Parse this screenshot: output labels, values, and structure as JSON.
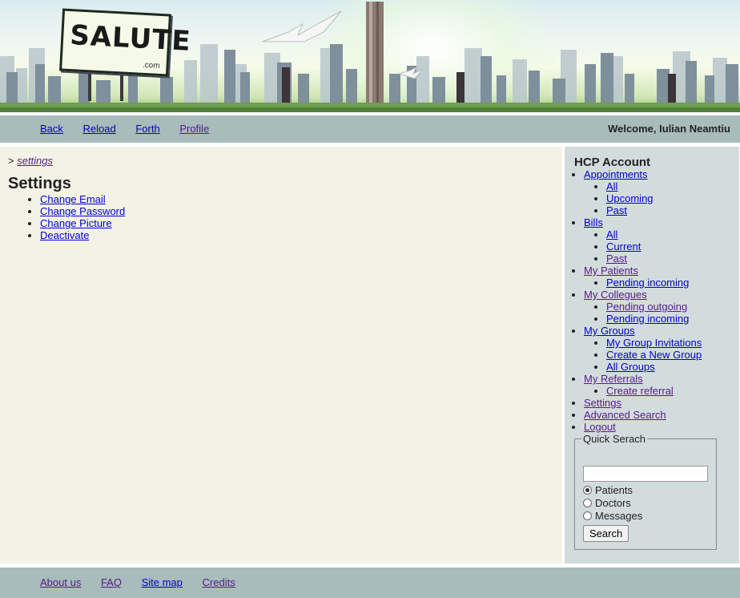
{
  "banner": {
    "logo_text": "SALUTE",
    "logo_sub": ".com"
  },
  "topbar": {
    "nav": [
      {
        "label": "Back",
        "visited": false
      },
      {
        "label": "Reload",
        "visited": false
      },
      {
        "label": "Forth",
        "visited": false
      },
      {
        "label": "Profile",
        "visited": true
      }
    ],
    "welcome": "Welcome, Iulian Neamtiu"
  },
  "main": {
    "breadcrumb_prefix": ">",
    "breadcrumb_link": "settings",
    "title": "Settings",
    "items": [
      "Change Email",
      "Change Password",
      "Change Picture",
      "Deactivate"
    ]
  },
  "sidebar": {
    "title": "HCP Account",
    "sections": [
      {
        "label": "Appointments",
        "children": [
          "All",
          "Upcoming",
          "Past"
        ]
      },
      {
        "label": "Bills",
        "children": [
          "All",
          "Current",
          "Past"
        ]
      },
      {
        "label": "My Patients",
        "children": [
          "Pending incoming"
        ]
      },
      {
        "label": "My Collegues",
        "children": [
          "Pending outgoing",
          "Pending incoming"
        ]
      },
      {
        "label": "My Groups",
        "children": [
          "My Group Invitations",
          "Create a New Group",
          "All Groups"
        ]
      },
      {
        "label": "My Referrals",
        "children": [
          "Create referral"
        ]
      },
      {
        "label": "Settings",
        "children": []
      },
      {
        "label": "Advanced Search",
        "children": []
      },
      {
        "label": "Logout",
        "children": []
      }
    ],
    "quick_search": {
      "legend": "Quick Serach",
      "input_value": "",
      "options": [
        "Patients",
        "Doctors",
        "Messages"
      ],
      "selected": "Patients",
      "button": "Search"
    }
  },
  "footer": {
    "links": [
      "About us",
      "FAQ",
      "Site map",
      "Credits"
    ]
  },
  "colors": {
    "bar": "#a8bcbc",
    "main_bg": "#f2f2e6",
    "sidebar_bg": "#d3dcdd",
    "link": "#0000cc",
    "visited": "#551a8b"
  }
}
